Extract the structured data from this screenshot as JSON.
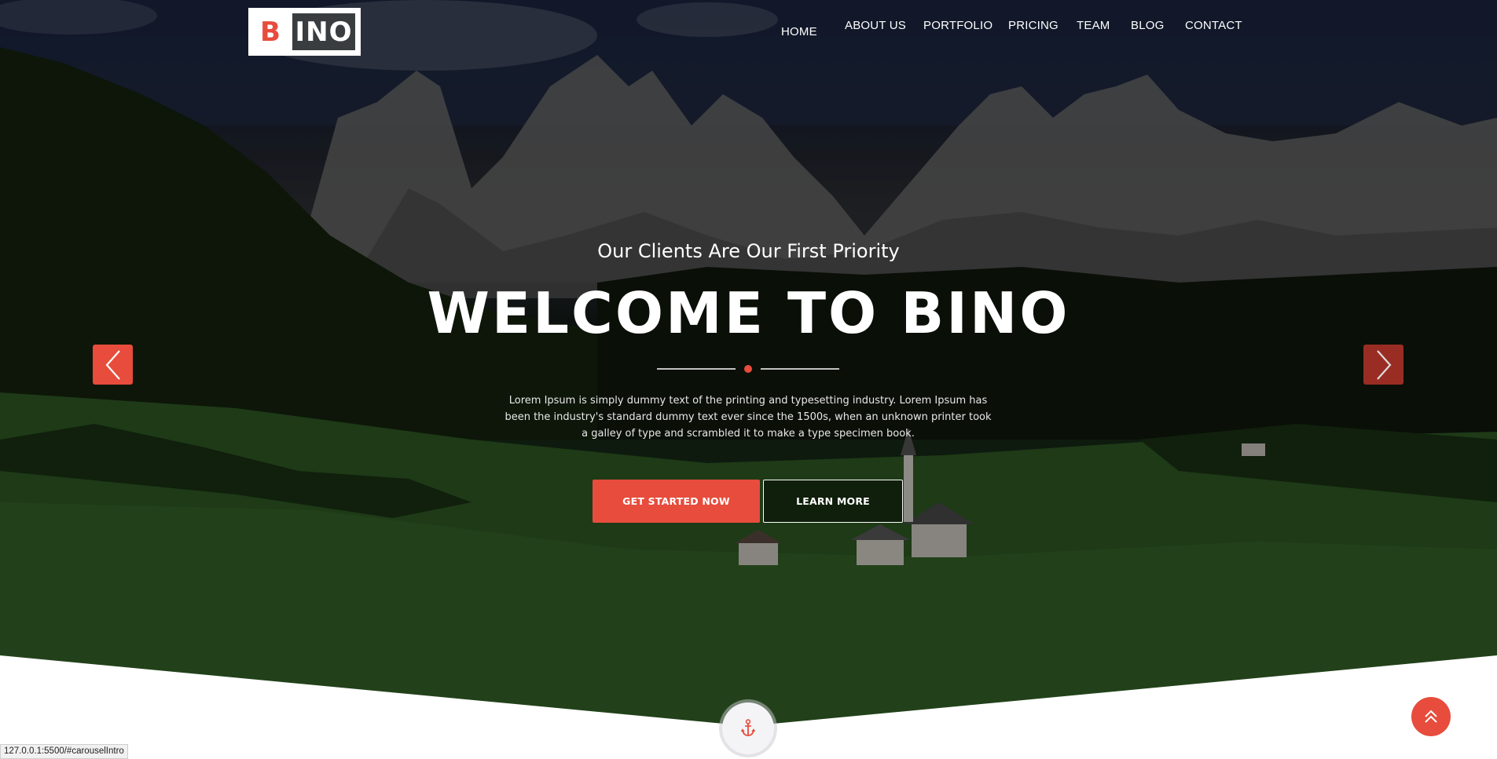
{
  "logo": {
    "letter": "B",
    "rest": "INO"
  },
  "nav": {
    "items": [
      "HOME",
      "ABOUT US",
      "PORTFOLIO",
      "PRICING",
      "TEAM",
      "BLOG",
      "CONTACT"
    ]
  },
  "hero": {
    "subtitle": "Our Clients Are Our First Priority",
    "title": "WELCOME TO BINO",
    "description": "Lorem Ipsum is simply dummy text of the printing and typesetting industry. Lorem Ipsum has been the industry's standard dummy text ever since the 1500s, when an unknown printer took a galley of type and scrambled it to make a type specimen book.",
    "primary_button": "GET STARTED NOW",
    "secondary_button": "LEARN MORE"
  },
  "status_bar": {
    "url": "127.0.0.1:5500/#carouselIntro"
  },
  "icons": {
    "prev": "chevron-left-icon",
    "next": "chevron-right-icon",
    "anchor": "anchor-icon",
    "scroll_top": "double-chevron-up-icon"
  },
  "colors": {
    "accent": "#e74c3c",
    "white": "#ffffff"
  }
}
